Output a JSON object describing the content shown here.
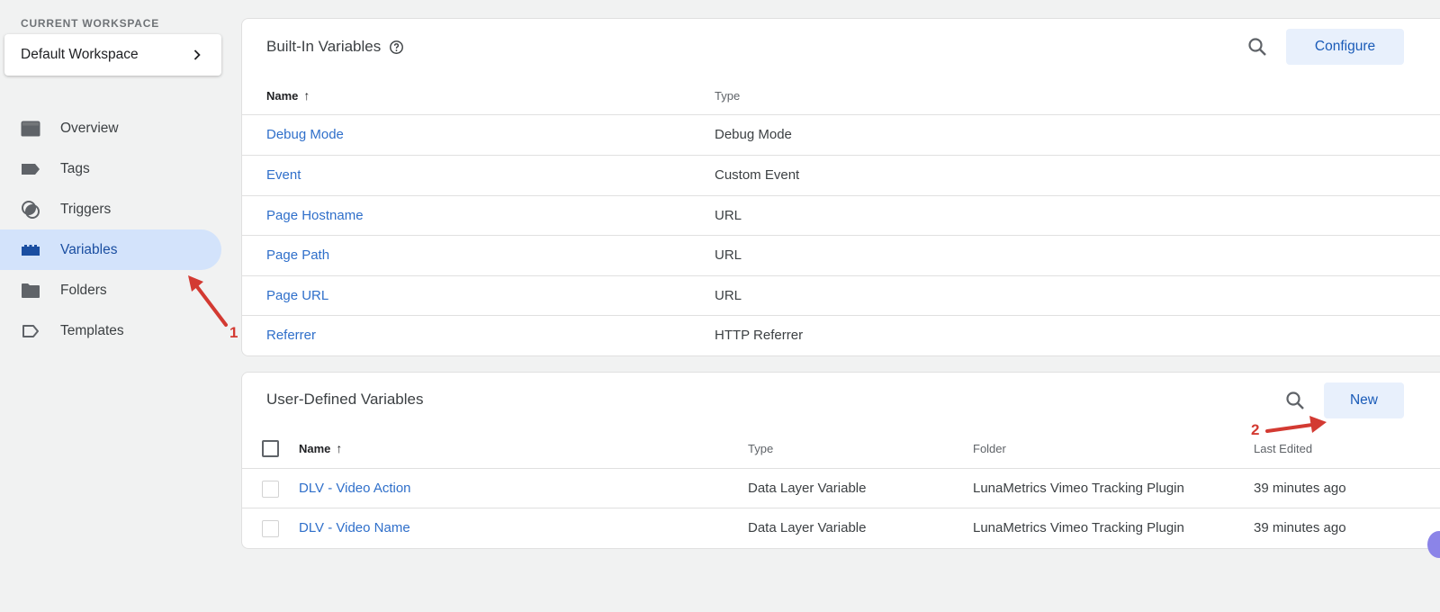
{
  "sidebar": {
    "workspace_label": "CURRENT WORKSPACE",
    "workspace_name": "Default Workspace",
    "items": [
      {
        "label": "Overview",
        "icon": "overview-icon",
        "active": false
      },
      {
        "label": "Tags",
        "icon": "tag-icon",
        "active": false
      },
      {
        "label": "Triggers",
        "icon": "trigger-icon",
        "active": false
      },
      {
        "label": "Variables",
        "icon": "variables-icon",
        "active": true
      },
      {
        "label": "Folders",
        "icon": "folder-icon",
        "active": false
      },
      {
        "label": "Templates",
        "icon": "template-icon",
        "active": false
      }
    ]
  },
  "builtin": {
    "title": "Built-In Variables",
    "configure_label": "Configure",
    "columns": {
      "name": "Name",
      "type": "Type"
    },
    "sort_indicator": "↑",
    "rows": [
      {
        "name": "Debug Mode",
        "type": "Debug Mode"
      },
      {
        "name": "Event",
        "type": "Custom Event"
      },
      {
        "name": "Page Hostname",
        "type": "URL"
      },
      {
        "name": "Page Path",
        "type": "URL"
      },
      {
        "name": "Page URL",
        "type": "URL"
      },
      {
        "name": "Referrer",
        "type": "HTTP Referrer"
      }
    ]
  },
  "userdefined": {
    "title": "User-Defined Variables",
    "new_label": "New",
    "columns": {
      "name": "Name",
      "type": "Type",
      "folder": "Folder",
      "last_edited": "Last Edited"
    },
    "sort_indicator": "↑",
    "rows": [
      {
        "name": "DLV - Video Action",
        "type": "Data Layer Variable",
        "folder": "LunaMetrics Vimeo Tracking Plugin",
        "last_edited": "39 minutes ago"
      },
      {
        "name": "DLV - Video Name",
        "type": "Data Layer Variable",
        "folder": "LunaMetrics Vimeo Tracking Plugin",
        "last_edited": "39 minutes ago"
      }
    ]
  },
  "annotations": {
    "step1": "1",
    "step2": "2",
    "color": "#d33a32"
  },
  "colors": {
    "accent": "#1a5bb8",
    "link": "#2f6fca",
    "active_nav_bg": "#d3e3fb",
    "button_bg": "#e8f0fc"
  }
}
